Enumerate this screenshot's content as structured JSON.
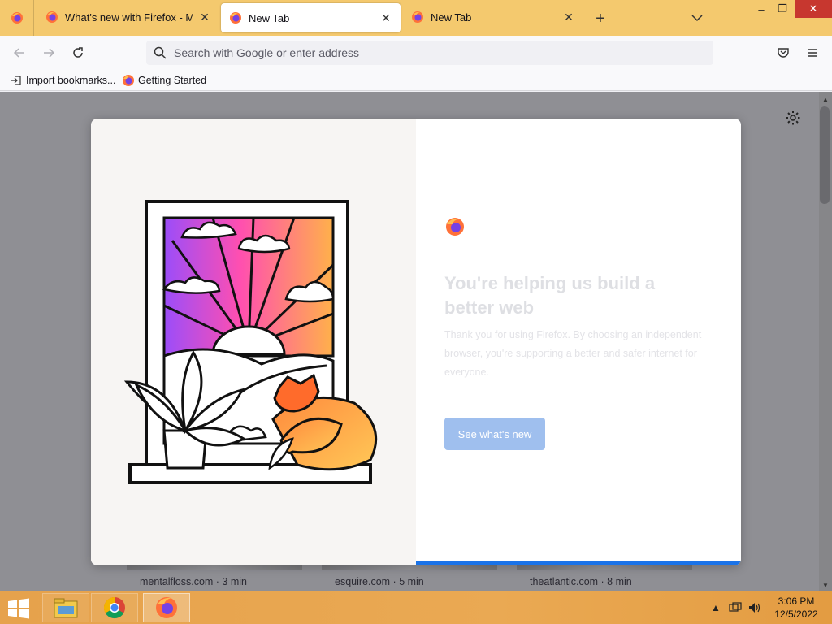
{
  "browser": {
    "tabs": [
      {
        "label": "What's new with Firefox - More",
        "active": false
      },
      {
        "label": "New Tab",
        "active": true
      },
      {
        "label": "New Tab",
        "active": false
      }
    ],
    "new_tab_label": "+",
    "window_controls": {
      "minimize": "–",
      "restore": "❐",
      "close": "✕"
    }
  },
  "navbar": {
    "back_icon": "back-arrow-icon",
    "forward_icon": "forward-arrow-icon",
    "reload_icon": "reload-icon",
    "url_placeholder": "Search with Google or enter address",
    "pocket_icon": "pocket-icon",
    "menu_icon": "hamburger-menu-icon"
  },
  "bookmarks": {
    "items": [
      {
        "label": "Import bookmarks...",
        "icon": "import-icon"
      },
      {
        "label": "Getting Started",
        "icon": "firefox-icon"
      }
    ]
  },
  "newtab": {
    "story_cards": [
      {
        "source": "mentalfloss.com · 3 min"
      },
      {
        "source": "esquire.com · 5 min"
      },
      {
        "source": "theatlantic.com · 8 min"
      }
    ]
  },
  "modal": {
    "title": "You're helping us build a better web",
    "body": "Thank you for using Firefox. By choosing an independent browser, you're supporting a better and safer internet for everyone.",
    "primary_button": "See what's new",
    "progress": 1.0
  },
  "taskbar": {
    "time": "3:06 PM",
    "date": "12/5/2022",
    "apps": [
      "file-explorer-icon",
      "chrome-icon",
      "firefox-icon"
    ]
  },
  "colors": {
    "tabbar": "#f4c96e",
    "modal_button": "#9fbfee",
    "progress": "#1a73e8",
    "taskbar": "#e8a44e"
  }
}
